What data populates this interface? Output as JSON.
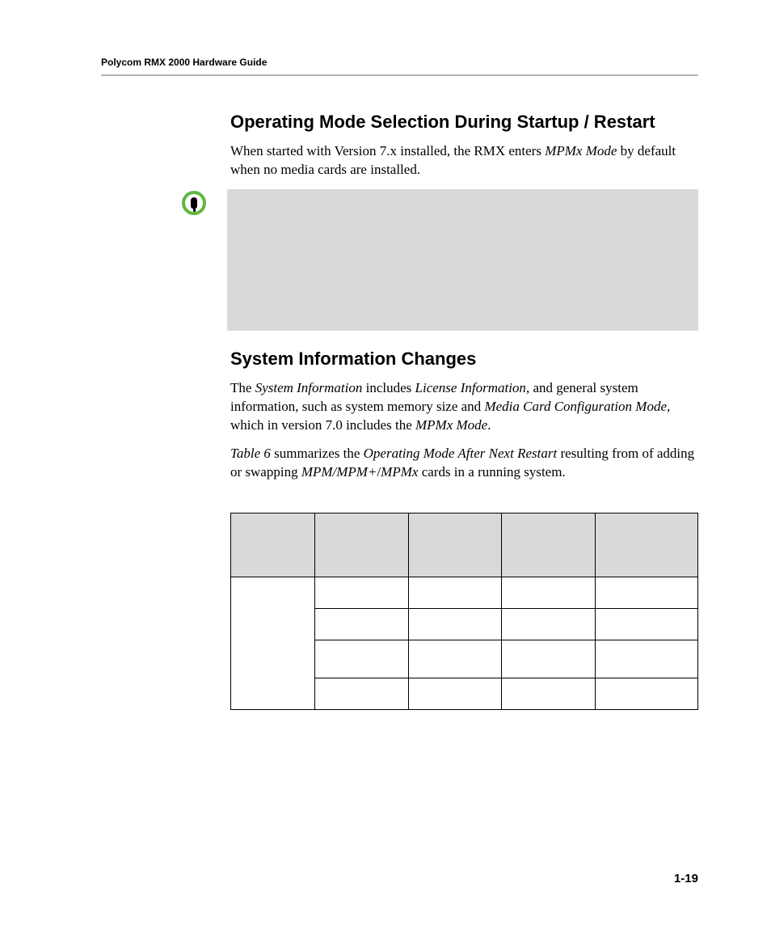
{
  "running_header": "Polycom RMX 2000 Hardware Guide",
  "section1": {
    "heading": "Operating Mode Selection During Startup / Restart",
    "para_pre": "When started with Version 7.x installed, the RMX enters ",
    "para_em": "MPMx Mode",
    "para_post": " by default when no media cards are installed."
  },
  "section2": {
    "heading": "System Information Changes",
    "p1_a": "The ",
    "p1_em1": "System Information",
    "p1_b": " includes ",
    "p1_em2": "License Information",
    "p1_c": ", and general system information, such as system memory size and ",
    "p1_em3": "Media Card Configuration Mode",
    "p1_d": ", which in version 7.0 includes the ",
    "p1_em4": "MPMx Mode",
    "p1_e": ".",
    "p2_em1": "Table 6",
    "p2_a": " summarizes the ",
    "p2_em2": "Operating Mode After Next Restart",
    "p2_b": " resulting from of adding or swapping ",
    "p2_em3": "MPM/MPM+",
    "p2_c": "/",
    "p2_em4": "MPMx",
    "p2_d": " cards in a running system."
  },
  "page_number": "1-19"
}
